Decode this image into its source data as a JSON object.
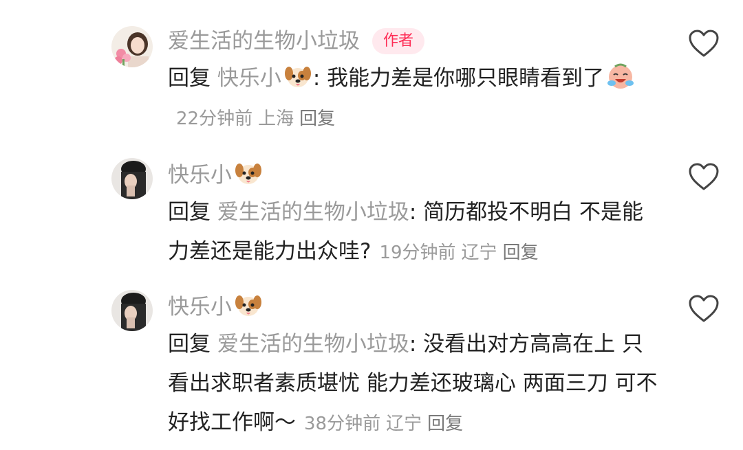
{
  "comments": [
    {
      "username": "爱生活的生物小垃圾",
      "badge": "作者",
      "reply_word": "回复",
      "reply_to": "快乐小",
      "colon": ": ",
      "text": "我能力差是你哪只眼睛看到了",
      "time": "22分钟前",
      "location": "上海",
      "reply_label": "回复",
      "avatar_icon": "girl-with-flowers-avatar",
      "reply_to_icon": "dog-face-emoji",
      "text_icon": "crying-laughing-face-emoji"
    },
    {
      "username": "快乐小",
      "reply_word": "回复",
      "reply_to": "爱生活的生物小垃圾",
      "colon": ": ",
      "text": "简历都投不明白 不是能力差还是能力出众哇?",
      "time": "19分钟前",
      "location": "辽宁",
      "reply_label": "回复",
      "avatar_icon": "person-black-hat-avatar",
      "username_icon": "dog-face-emoji"
    },
    {
      "username": "快乐小",
      "reply_word": "回复",
      "reply_to": "爱生活的生物小垃圾",
      "colon": ": ",
      "text": "没看出对方高高在上 只看出求职者素质堪忧 能力差还玻璃心 两面三刀 可不好找工作啊～",
      "time": "38分钟前",
      "location": "辽宁",
      "reply_label": "回复",
      "avatar_icon": "person-black-hat-avatar",
      "username_icon": "dog-face-emoji"
    }
  ],
  "colors": {
    "author_badge": "#fe2c55",
    "muted": "#9a9a9a",
    "text": "#222222"
  }
}
